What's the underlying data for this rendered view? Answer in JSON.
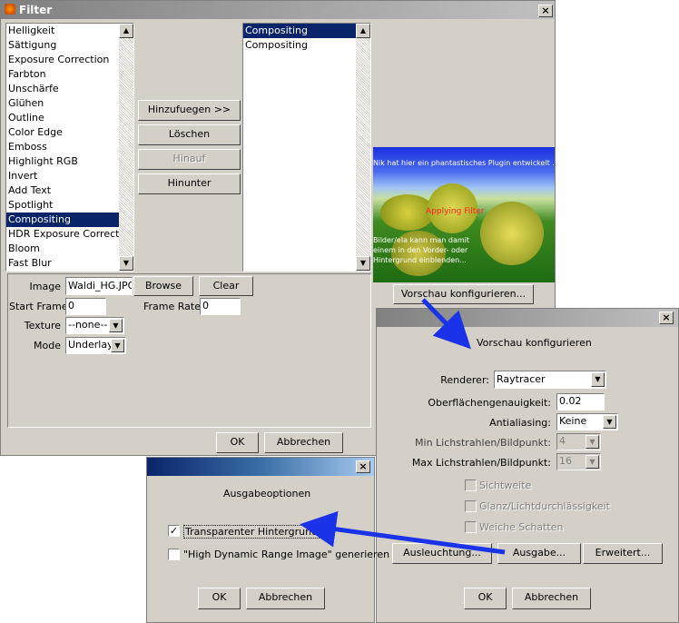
{
  "filter": {
    "title": "Filter",
    "filters": [
      "Helligkeit",
      "Sättigung",
      "Exposure Correction",
      "Farbton",
      "Unschärfe",
      "Glühen",
      "Outline",
      "Color Edge",
      "Emboss",
      "Highlight RGB",
      "Invert",
      "Add Text",
      "Spotlight",
      "Compositing",
      "HDR Exposure Correction",
      "Bloom",
      "Fast Blur"
    ],
    "selected_filter": "Compositing",
    "active_filters": [
      "Compositing",
      "Compositing"
    ],
    "buttons": {
      "add": "Hinzufuegen >>",
      "delete": "Löschen",
      "up": "Hinauf",
      "down": "Hinunter"
    },
    "image_label": "Image",
    "image_value": "Waldi_HG.JPG",
    "browse": "Browse",
    "clear": "Clear",
    "start_frame_label": "Start Frame",
    "start_frame_value": "0",
    "frame_rate_label": "Frame Rate",
    "frame_rate_value": "0",
    "texture_label": "Texture",
    "texture_value": "--none--",
    "mode_label": "Mode",
    "mode_value": "Underlay",
    "preview_text_top": "Nik hat hier ein phantastisches Plugin entwickelt ...",
    "preview_text_mid": "Applying Filter",
    "preview_text_bottom": "Bilder/ela kann man damit einem in den Vorder- oder Hintergrund einblenden...",
    "preview_config": "Vorschau konfigurieren...",
    "ok": "OK",
    "cancel": "Abbrechen"
  },
  "preview_dialog": {
    "heading": "Vorschau konfigurieren",
    "renderer_label": "Renderer:",
    "renderer_value": "Raytracer",
    "surface_label": "Oberflächengenauigkeit:",
    "surface_value": "0.02",
    "aa_label": "Antialiasing:",
    "aa_value": "Keine",
    "min_label": "Min Lichstrahlen/Bildpunkt:",
    "min_value": "4",
    "max_label": "Max Lichstrahlen/Bildpunkt:",
    "max_value": "16",
    "softness": "Sichtweite",
    "gloss": "Glanz/Lichtdurchlässigkeit",
    "soft_shadows": "Weiche Schatten",
    "lighting": "Ausleuchtung...",
    "output": "Ausgabe...",
    "advanced": "Erweitert...",
    "ok": "OK",
    "cancel": "Abbrechen"
  },
  "output_dialog": {
    "heading": "Ausgabeoptionen",
    "transparent": "Transparenter Hintergrund",
    "transparent_checked": true,
    "hdr": "\"High Dynamic Range Image\" generieren",
    "hdr_checked": false,
    "ok": "OK",
    "cancel": "Abbrechen"
  },
  "colors": {
    "selection": "#0a246a",
    "dialog": "#d4d0c8",
    "arrow": "#1a33e8"
  }
}
